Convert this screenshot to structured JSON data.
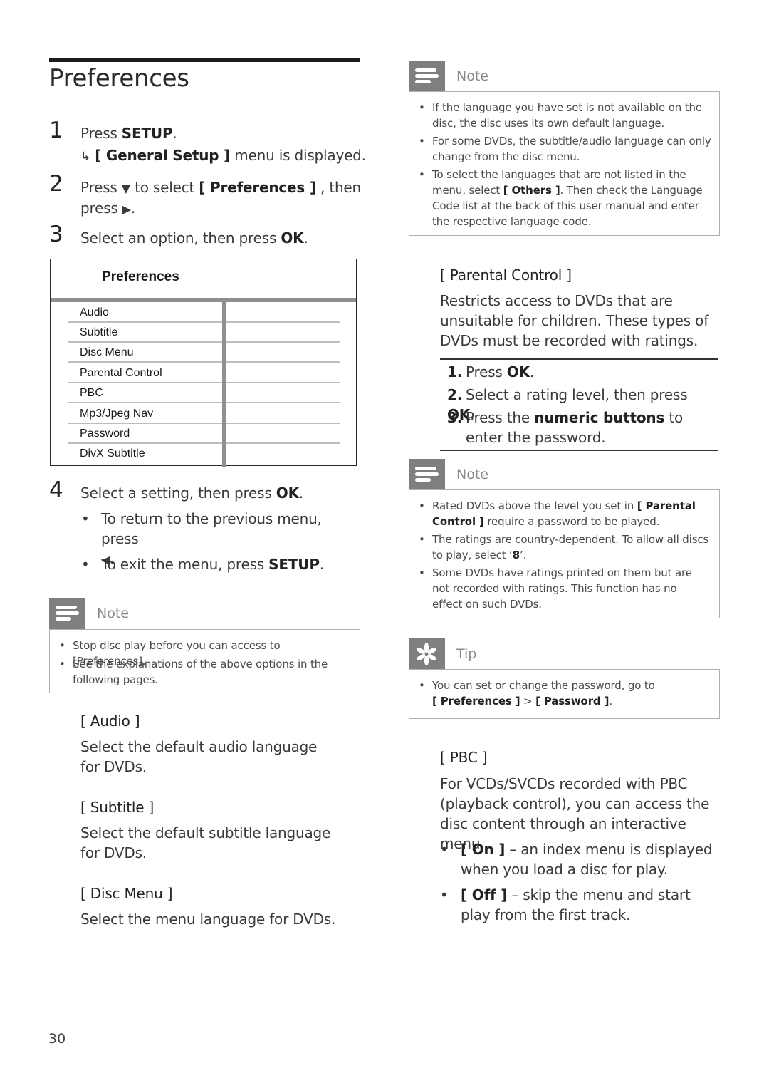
{
  "page": {
    "title": "Preferences",
    "page_number": "30"
  },
  "steps": {
    "s1": {
      "num": "1",
      "pre": "Press ",
      "bold": "SETUP",
      "post": ".",
      "result_arrow": "↳",
      "result_bold": "[ General Setup ]",
      "result_post": " menu is displayed."
    },
    "s2": {
      "num": "2",
      "pre": "Press ",
      "down_icon": "▼",
      "mid": " to select ",
      "bold": "[ Preferences ]",
      "post": " , then",
      "line2_pre": "press ",
      "right_icon": "▶",
      "line2_post": "."
    },
    "s3": {
      "num": "3",
      "pre": "Select an option, then press ",
      "bold": "OK",
      "post": "."
    },
    "s4": {
      "num": "4",
      "pre": "Select a setting, then press ",
      "bold": "OK",
      "post": ".",
      "bullets": [
        {
          "text": "To return to the previous menu, press",
          "icon": "◀",
          "post": "."
        },
        {
          "pre": "To exit the menu, press ",
          "bold": "SETUP",
          "post": "."
        }
      ]
    }
  },
  "menu": {
    "title": "Preferences",
    "items": [
      "Audio",
      "Subtitle",
      "Disc Menu",
      "Parental Control",
      "PBC",
      "Mp3/Jpeg Nav",
      "Password",
      "DivX Subtitle"
    ]
  },
  "note_left": {
    "label": "Note",
    "items": [
      "Stop disc play before you can access to [Preferences].",
      "See the explanations of the above options in the following pages."
    ]
  },
  "sections_left": [
    {
      "head": "[ Audio ]",
      "text": "Select the default audio language for DVDs."
    },
    {
      "head": "[ Subtitle ]",
      "text": "Select the default subtitle language for DVDs."
    },
    {
      "head": "[ Disc Menu ]",
      "text": "Select the menu language for DVDs."
    }
  ],
  "note_right_1": {
    "label": "Note",
    "items": [
      {
        "text": "If the language you have set is not available on the disc, the disc uses its own default language."
      },
      {
        "text": "For some DVDs, the subtitle/audio language can only change from the disc menu."
      },
      {
        "pre": "To select the languages that are not listed in the menu, select ",
        "bold": "[ Others ]",
        "post": ". Then check the Language Code list at the back of this user manual and enter the respective language code."
      }
    ]
  },
  "parental": {
    "head": "[ Parental Control ]",
    "text": "Restricts access to DVDs that are unsuitable for children. These types of DVDs must be recorded with ratings.",
    "steps": [
      {
        "num": "1.",
        "pre": "Press ",
        "bold": "OK",
        "post": "."
      },
      {
        "num": "2.",
        "pre": "Select a rating level, then press ",
        "bold": "OK",
        "post": "."
      },
      {
        "num": "3.",
        "pre": "Press the ",
        "bold": "numeric buttons",
        "post": " to enter the password."
      }
    ]
  },
  "note_right_2": {
    "label": "Note",
    "items": [
      {
        "pre": "Rated DVDs above the level you set in ",
        "bold": "[ Parental Control ]",
        "post": " require a password to be played."
      },
      {
        "pre": "The ratings are country-dependent. To allow all discs to play, select ‘",
        "bold": "8",
        "post": "’."
      },
      {
        "pre": "Some DVDs have ratings printed on them but are not recorded with ratings.  This function has no effect on such DVDs."
      }
    ]
  },
  "tip": {
    "label": "Tip",
    "pre": "You can set or change the password, go to ",
    "bold1": "[ Preferences ]",
    "sep": " > ",
    "bold2": "[ Password ]",
    "post": "."
  },
  "pbc": {
    "head": "[ PBC ]",
    "text": "For VCDs/SVCDs recorded with PBC (playback control), you can access the disc content through an interactive menu.",
    "options": [
      {
        "bold": "[ On ]",
        "text": " – an index menu is displayed when you load a disc for play."
      },
      {
        "bold": "[ Off ]",
        "text": " – skip the menu and start play from the first track."
      }
    ]
  },
  "colors": {
    "icon_box": "#7f7f7f",
    "note_border": "#a9b1b5",
    "menu_bar": "#8f8f8f",
    "menu_line": "#bdbdbd"
  }
}
